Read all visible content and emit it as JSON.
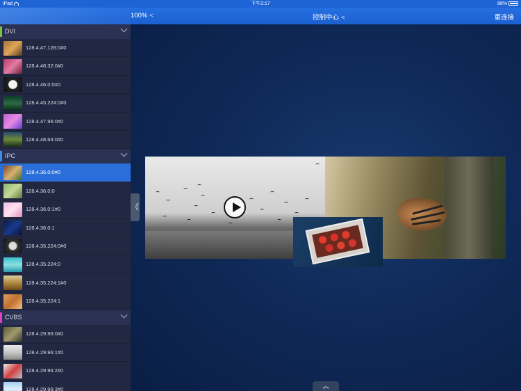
{
  "status_bar": {
    "device": "iPad",
    "time": "下午2:17",
    "battery": "88%"
  },
  "nav": {
    "zoom": "100%",
    "title": "控制中心",
    "reconnect": "重连接",
    "chevron": "<"
  },
  "groups": [
    {
      "name": "DVI",
      "color": "#7cc242",
      "items": [
        {
          "label": "128.4.47.128:0#0",
          "thumb": "linear-gradient(135deg,#a8743a,#e0a65a,#5a3a1e)"
        },
        {
          "label": "128.4.48.32:0#0",
          "thumb": "linear-gradient(135deg,#b63c6a,#e37aa0,#6a1f3c)"
        },
        {
          "label": "128.4.46.0:0#0",
          "thumb": "radial-gradient(circle,#f4f4f4 35%,#222 40%,#111)"
        },
        {
          "label": "128.4.45.224:0#0",
          "thumb": "linear-gradient(180deg,#0d3a2a,#2c6a42,#0a2a1a)"
        },
        {
          "label": "128.4.47.96:0#0",
          "thumb": "linear-gradient(135deg,#c25fd1,#e38be3,#6a3bd0)"
        },
        {
          "label": "128.4.48.64:0#0",
          "thumb": "linear-gradient(180deg,#2a4a6a,#6a8a3a,#1a2a1a)"
        }
      ]
    },
    {
      "name": "IPC",
      "color": "#3a8ee6",
      "items": [
        {
          "label": "128.4.36.0:0#0",
          "selected": true,
          "thumb": "linear-gradient(135deg,#7a4a2a,#d8b070,#3a6a2a)"
        },
        {
          "label": "128.4.36.0:0",
          "thumb": "linear-gradient(135deg,#8ab86a,#c8d89a,#5a7a3a)"
        },
        {
          "label": "128.4.36.0:1#0",
          "thumb": "linear-gradient(135deg,#f0c0e0,#ffe0f0,#e090c0)"
        },
        {
          "label": "128.4.36.0:1",
          "thumb": "linear-gradient(135deg,#0a1a4a,#1a3a8a,#0a1030)"
        },
        {
          "label": "128.4.35.224:0#0",
          "thumb": "radial-gradient(circle,#ddd 30%,#333 40%,#111)"
        },
        {
          "label": "128.4.35.224:0",
          "thumb": "linear-gradient(180deg,#3ac0d0,#8ae0e0,#2a9ab0)"
        },
        {
          "label": "128.4.35.224:1#0",
          "thumb": "linear-gradient(180deg,#e0d0a0,#b08a40,#6a4a1a)"
        },
        {
          "label": "128.4.35.224:1",
          "thumb": "linear-gradient(135deg,#e0a060,#c07030,#f0c080)"
        }
      ]
    },
    {
      "name": "CVBS",
      "color": "#e040c0",
      "items": [
        {
          "label": "128.4.29.96:0#0",
          "thumb": "linear-gradient(135deg,#5a5a3a,#a09a6a,#3a3a2a)"
        },
        {
          "label": "128.4.29.96:1#0",
          "thumb": "linear-gradient(180deg,#e8e8e8,#c8c8c8,#8a8a8a)"
        },
        {
          "label": "128.4.29.96:2#0",
          "thumb": "linear-gradient(135deg,#f0f0f0,#d04040,#c0c0c0)"
        },
        {
          "label": "128.4.29.96:3#0",
          "thumb": "linear-gradient(180deg,#a0d0f0,#e0f0ff,#80b0d0)"
        }
      ]
    }
  ],
  "main": {
    "collapse_label": "《",
    "bottom_handle": "︽"
  }
}
